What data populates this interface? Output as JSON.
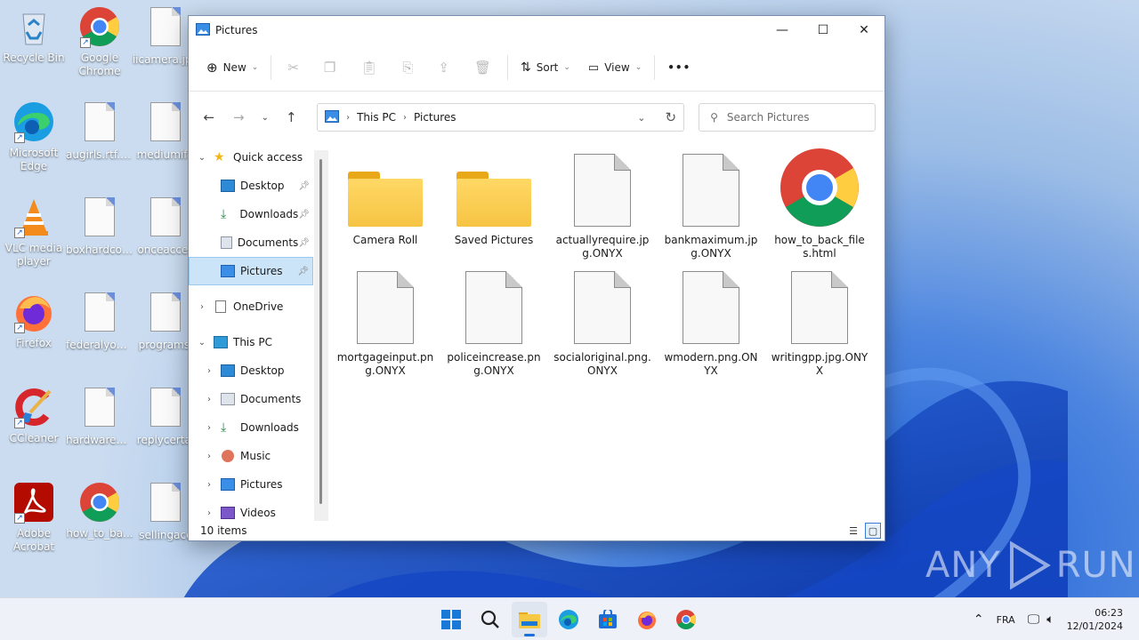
{
  "desktop": {
    "icons": [
      {
        "label": "Recycle Bin"
      },
      {
        "label": "Google Chrome"
      },
      {
        "label": "iicamera.jpg"
      },
      {
        "label": "Microsoft Edge"
      },
      {
        "label": "augirls.rtf.O..."
      },
      {
        "label": "mediumif.r"
      },
      {
        "label": "VLC media player"
      },
      {
        "label": "boxhardcor..."
      },
      {
        "label": "onceacces"
      },
      {
        "label": "Firefox"
      },
      {
        "label": "federalyou...."
      },
      {
        "label": "programsi"
      },
      {
        "label": "CCleaner"
      },
      {
        "label": "hardwarepr..."
      },
      {
        "label": "replycertai"
      },
      {
        "label": "Adobe Acrobat"
      },
      {
        "label": "how_to_ba..."
      },
      {
        "label": "sellingacc"
      }
    ]
  },
  "window": {
    "title": "Pictures",
    "toolbar": {
      "new_label": "New",
      "sort_label": "Sort",
      "view_label": "View",
      "more_label": "•••"
    },
    "address": {
      "crumbs": [
        "This PC",
        "Pictures"
      ],
      "search_placeholder": "Search Pictures"
    },
    "nav": {
      "quick_access": "Quick access",
      "qa_items": [
        "Desktop",
        "Downloads",
        "Documents",
        "Pictures"
      ],
      "onedrive": "OneDrive",
      "this_pc": "This PC",
      "pc_items": [
        "Desktop",
        "Documents",
        "Downloads",
        "Music",
        "Pictures",
        "Videos"
      ]
    },
    "files": [
      {
        "name": "Camera Roll",
        "kind": "folder"
      },
      {
        "name": "Saved Pictures",
        "kind": "folder"
      },
      {
        "name": "actuallyrequire.jpg.ONYX",
        "kind": "file"
      },
      {
        "name": "bankmaximum.jpg.ONYX",
        "kind": "file"
      },
      {
        "name": "how_to_back_files.html",
        "kind": "chrome"
      },
      {
        "name": "mortgageinput.png.ONYX",
        "kind": "file"
      },
      {
        "name": "policeincrease.png.ONYX",
        "kind": "file"
      },
      {
        "name": "socialoriginal.png.ONYX",
        "kind": "file"
      },
      {
        "name": "wmodern.png.ONYX",
        "kind": "file"
      },
      {
        "name": "writingpp.jpg.ONYX",
        "kind": "file"
      }
    ],
    "status": "10 items"
  },
  "taskbar": {
    "apps": [
      "start-icon",
      "search-icon",
      "file-explorer-icon",
      "edge-icon",
      "store-icon",
      "firefox-icon",
      "chrome-icon"
    ],
    "language": "FRA",
    "time": "06:23",
    "date": "12/01/2024"
  },
  "watermark": {
    "text": "ANY",
    "text2": "RUN"
  },
  "colors": {
    "accent": "#1a6fd8",
    "selection": "#cce4f7",
    "folder": "#f6c443"
  }
}
